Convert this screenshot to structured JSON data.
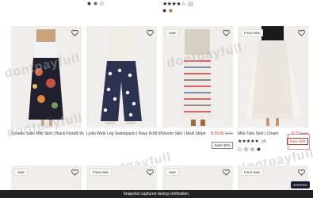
{
  "top_row": {
    "left_swatches": [
      "#222222",
      "#8a5a48",
      "#eeeeee"
    ],
    "right_rating": "★★★★☆",
    "right_rating_count": "(1)",
    "right_swatches": [
      "#222222",
      "#c9702e"
    ]
  },
  "products": [
    {
      "title": "Cosette Satin Midi Skirt | Black Floral",
      "price": "$ 66",
      "badge": ""
    },
    {
      "title": "Lydia Wide Leg Sweatpants | Navy Dot",
      "price": "$ 65",
      "badge": ""
    },
    {
      "title": "Viento Skirt | Multi Stripe",
      "price": "$ 59.95",
      "orig_price": "$ 66",
      "pct": "Save 30%",
      "badge": "Sale"
    },
    {
      "title": "Mila Tulle Skirt | Cream",
      "price": "$ 33",
      "orig_price": "$ 44",
      "pct": "Save 40%",
      "badge": "Final Sale",
      "rating": "★★★★★",
      "rating_count": "(4)",
      "swatches": [
        "#f3eee6",
        "#e6b3c7",
        "#c6c6c6",
        "#222222"
      ]
    }
  ],
  "bottom_badges": [
    "Sale",
    "Final Sale",
    "Sale",
    "Final Sale"
  ],
  "watermark": "dontpayfull",
  "caption": "Snapshot captured during verification.",
  "verified": "VERIFIED"
}
